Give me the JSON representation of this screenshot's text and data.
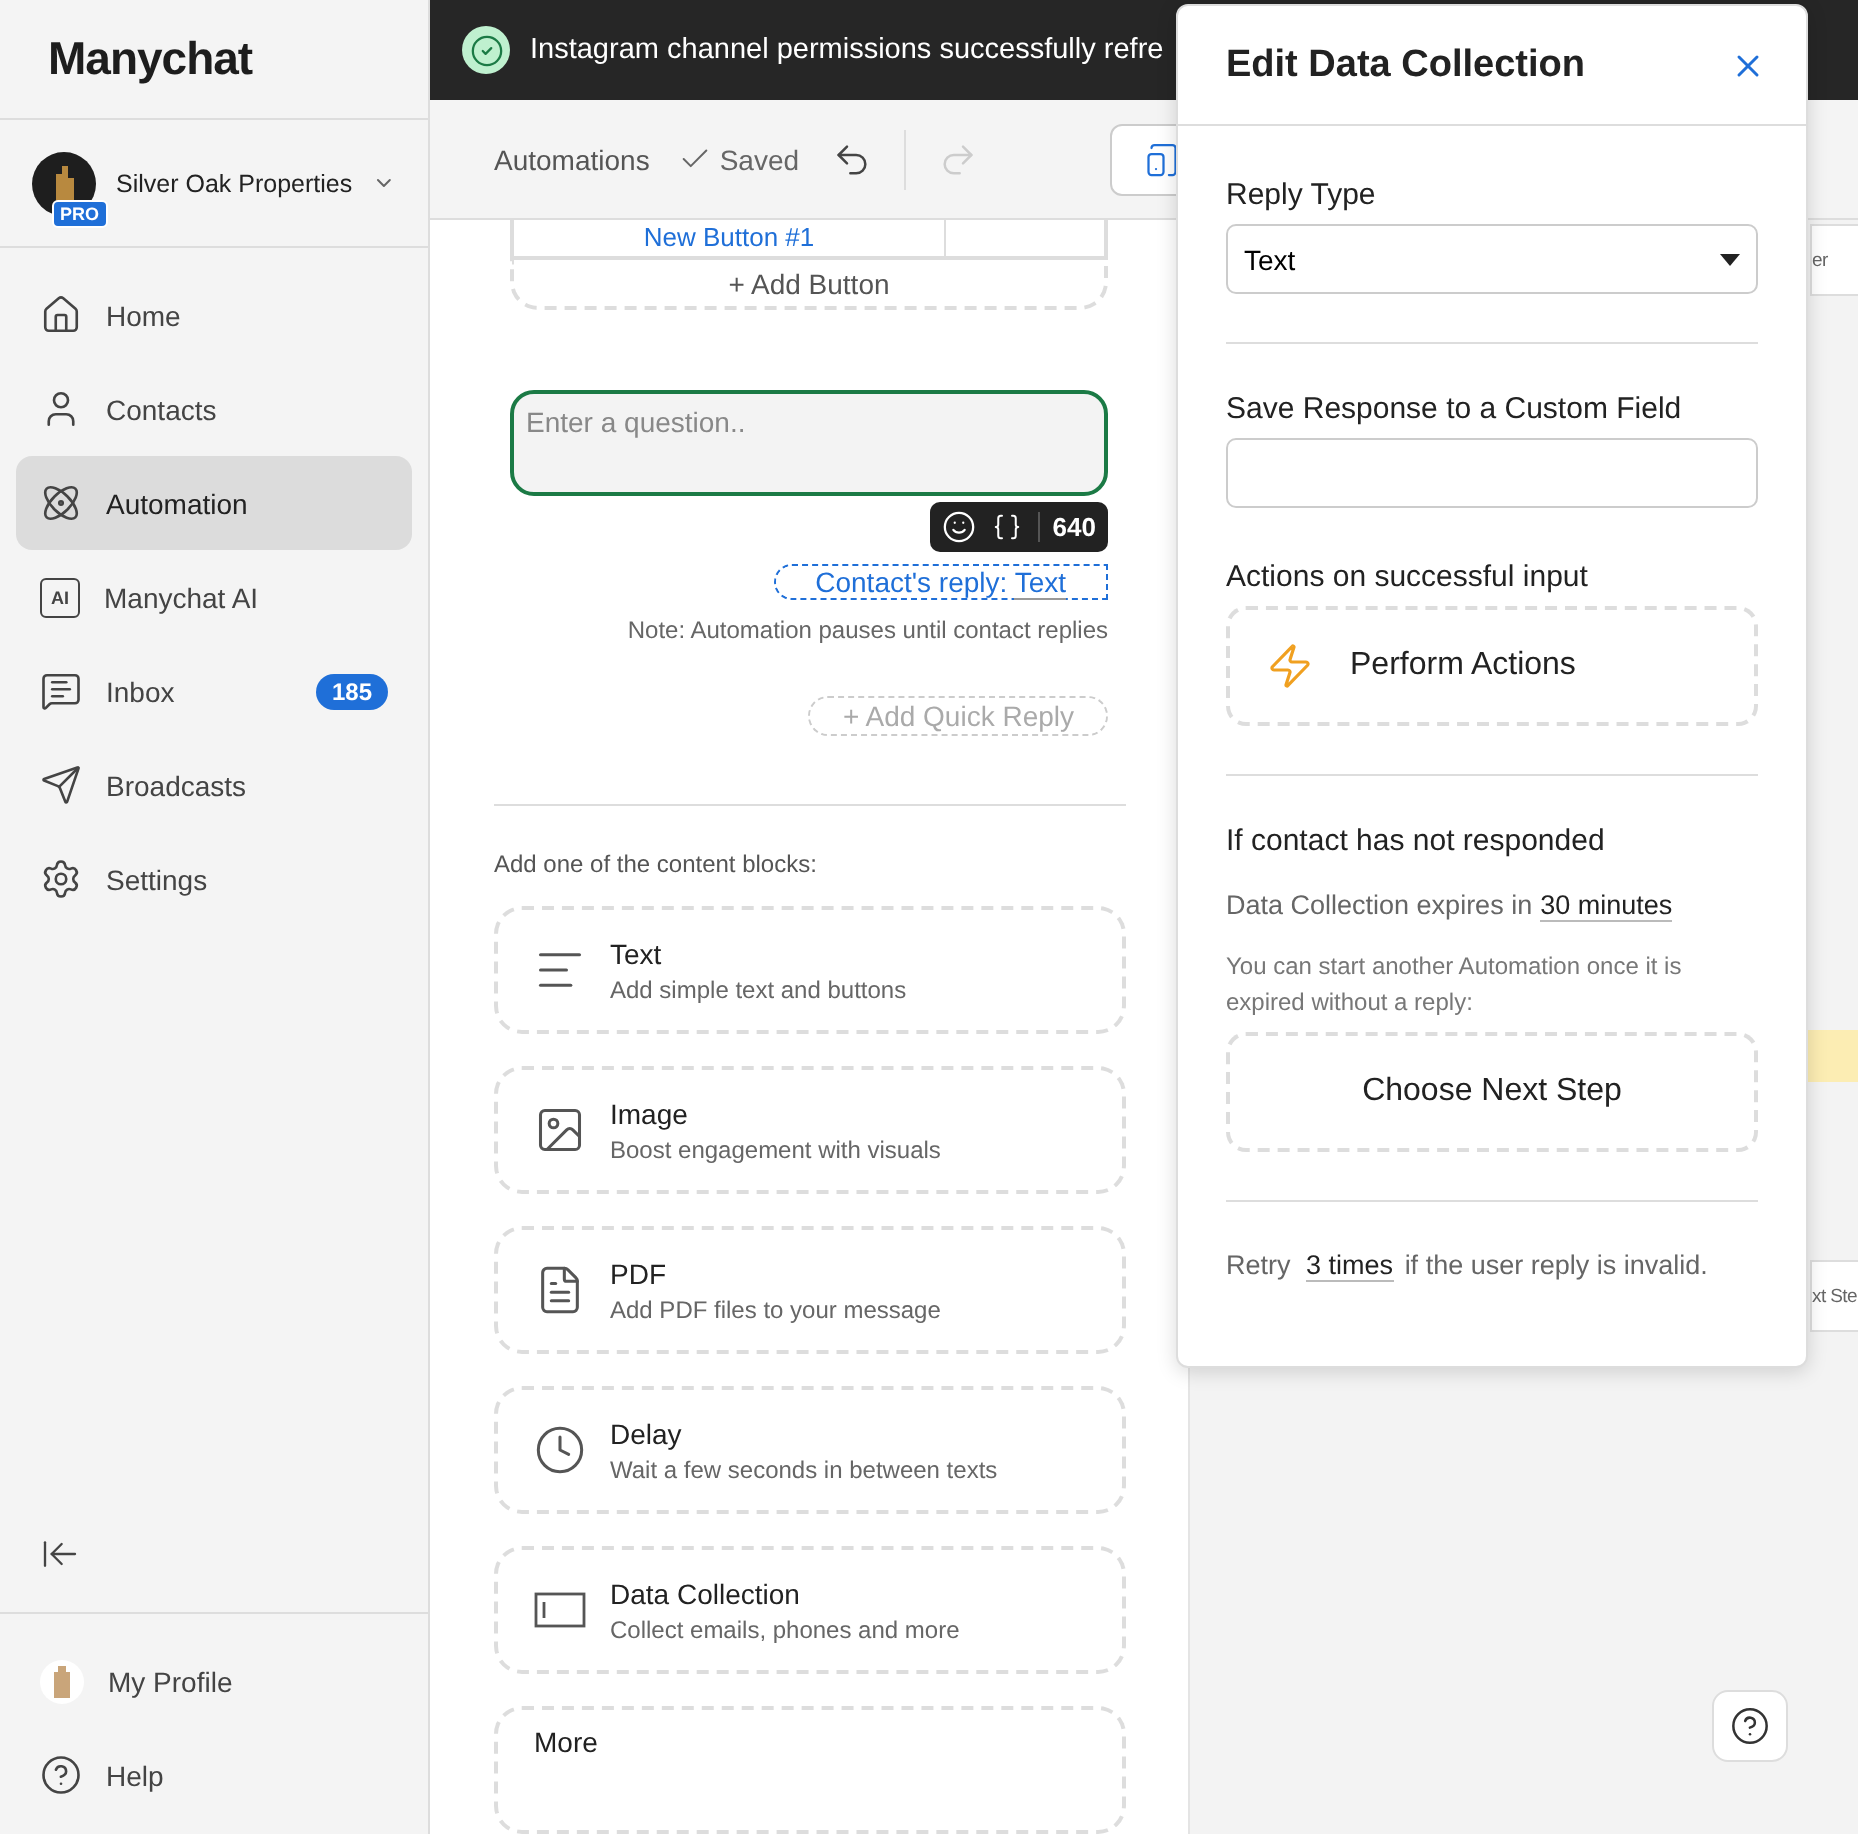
{
  "sidebar": {
    "logo": "Manychat",
    "account": {
      "name": "Silver Oak Properties",
      "badge": "PRO"
    },
    "items": [
      {
        "label": "Home",
        "selected": false
      },
      {
        "label": "Contacts",
        "selected": false
      },
      {
        "label": "Automation",
        "selected": true
      },
      {
        "label": "Manychat AI",
        "icon_text": "AI",
        "selected": false
      },
      {
        "label": "Inbox",
        "badge": "185",
        "selected": false
      },
      {
        "label": "Broadcasts",
        "selected": false
      },
      {
        "label": "Settings",
        "selected": false
      }
    ],
    "footer": [
      {
        "label": "My Profile"
      },
      {
        "label": "Help"
      }
    ]
  },
  "toast": {
    "text": "Instagram channel permissions successfully refre"
  },
  "toolbar": {
    "breadcrumb": "Automations",
    "status": "Saved",
    "undo": {
      "disabled": false
    },
    "redo": {
      "disabled": true
    }
  },
  "editor": {
    "button_label": "New Button #1",
    "add_button": "+ Add Button",
    "question": {
      "placeholder": "Enter a question.."
    },
    "counter": "640",
    "reply_chip": {
      "label": "Contact's reply:",
      "value": "Text"
    },
    "note": "Note: Automation pauses until contact replies",
    "add_quick_reply": "+ Add Quick Reply",
    "blocks_heading": "Add one of the content blocks:",
    "blocks": [
      {
        "title": "Text",
        "description": "Add simple text and buttons"
      },
      {
        "title": "Image",
        "description": "Boost engagement with visuals"
      },
      {
        "title": "PDF",
        "description": "Add PDF files to your message"
      },
      {
        "title": "Delay",
        "description": "Wait a few seconds in between texts"
      },
      {
        "title": "Data Collection",
        "description": "Collect emails, phones and more"
      },
      {
        "title": "More"
      }
    ]
  },
  "canvas": {
    "fragments": [
      "er",
      "xt Ste"
    ]
  },
  "modal": {
    "title": "Edit Data Collection",
    "reply_type": {
      "label": "Reply Type",
      "value": "Text"
    },
    "custom_field": {
      "label": "Save Response to a Custom Field"
    },
    "actions": {
      "label": "Actions on successful input",
      "button": "Perform Actions"
    },
    "no_response": {
      "heading": "If contact has not responded",
      "expires_label": "Data Collection expires in",
      "expires_value": "30 minutes",
      "hint": "You can start another Automation once it is expired without a reply:",
      "button": "Choose Next Step"
    },
    "retry": {
      "prefix": "Retry",
      "value": "3 times",
      "suffix": "if the user reply is invalid."
    }
  }
}
